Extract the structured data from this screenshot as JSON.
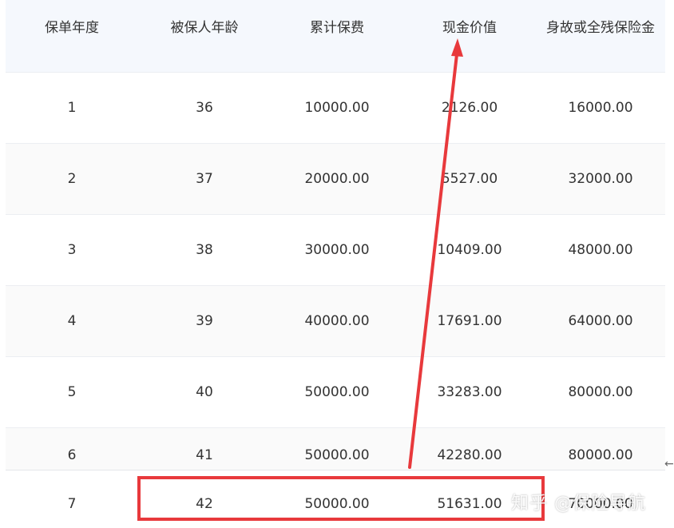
{
  "table": {
    "headers": [
      "保单年度",
      "被保人年龄",
      "累计保费",
      "现金价值",
      "身故或全残保险金"
    ],
    "rows": [
      [
        "1",
        "36",
        "10000.00",
        "2126.00",
        "16000.00"
      ],
      [
        "2",
        "37",
        "20000.00",
        "5527.00",
        "32000.00"
      ],
      [
        "3",
        "38",
        "30000.00",
        "10409.00",
        "48000.00"
      ],
      [
        "4",
        "39",
        "40000.00",
        "17691.00",
        "64000.00"
      ],
      [
        "5",
        "40",
        "50000.00",
        "33283.00",
        "80000.00"
      ],
      [
        "6",
        "41",
        "50000.00",
        "42280.00",
        "80000.00"
      ],
      [
        "7",
        "42",
        "50000.00",
        "51631.00",
        "70000.00"
      ]
    ]
  },
  "overlay": {
    "watermark": "知乎 @保险导航",
    "back_icon": "←",
    "annotation_color": "#e8393c"
  }
}
